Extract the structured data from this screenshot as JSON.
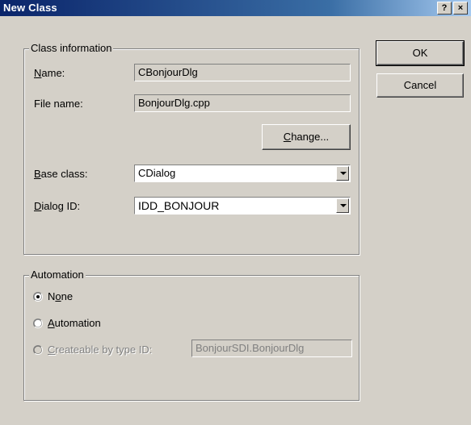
{
  "window": {
    "title": "New Class",
    "help_label": "?",
    "close_label": "×"
  },
  "class_info": {
    "group_label": "Class information",
    "name": {
      "label_first": "N",
      "label_rest": "ame:",
      "value": "CBonjourDlg"
    },
    "file_name": {
      "label": "File name:",
      "value": "BonjourDlg.cpp"
    },
    "change_button": {
      "first": "C",
      "rest": "hange..."
    },
    "base_class": {
      "label_first": "B",
      "label_rest": "ase class:",
      "value": "CDialog"
    },
    "dialog_id": {
      "label_first": "D",
      "label_rest": "ialog ID:",
      "value": "IDD_BONJOUR"
    }
  },
  "automation": {
    "group_label": "Automation",
    "options": [
      {
        "pre": "N",
        "u": "o",
        "post": "ne",
        "selected": true,
        "enabled": true
      },
      {
        "pre": "",
        "u": "A",
        "post": "utomation",
        "selected": false,
        "enabled": true
      },
      {
        "pre": "",
        "u": "C",
        "post": "reateable by type ID:",
        "selected": false,
        "enabled": false
      }
    ],
    "type_id_value": "BonjourSDI.BonjourDlg"
  },
  "buttons": {
    "ok": "OK",
    "cancel": "Cancel"
  }
}
